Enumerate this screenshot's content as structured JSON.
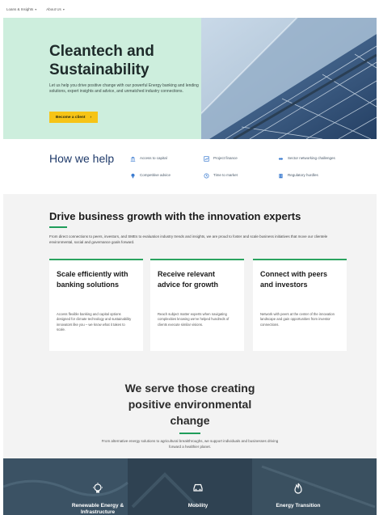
{
  "topnav": {
    "items": [
      {
        "label": "Loans & Insights"
      },
      {
        "label": "About Us"
      }
    ]
  },
  "hero": {
    "title": "Cleantech and Sustainability",
    "description": "Let us help you drive positive change with our powerful Energy banking and lending solutions, expert insights and advice, and unmatched industry connections.",
    "cta_label": "Become a client",
    "cta_color": "#f6c416",
    "bg_color": "#cdeedd"
  },
  "how": {
    "title": "How we help",
    "items": [
      {
        "label": "Access to capital",
        "icon": "bank-icon"
      },
      {
        "label": "Project finance",
        "icon": "chart-icon"
      },
      {
        "label": "Sector networking challenges",
        "icon": "handshake-icon"
      },
      {
        "label": "Competitive advice",
        "icon": "lightbulb-icon"
      },
      {
        "label": "Time to market",
        "icon": "clock-icon"
      },
      {
        "label": "Regulatory hurdles",
        "icon": "building-icon"
      }
    ]
  },
  "drive": {
    "title": "Drive business growth with the innovation experts",
    "lead": "From direct connections to peers, investors, and SMEs to evaluation industry trends and insights, we are proud to foster and scale business initiatives that move our clientele environmental, social and governance goals forward.",
    "accent": "#1f9d5a",
    "cards": [
      {
        "title": "Scale efficiently with banking solutions",
        "body": "Access flexible banking and capital options designed for climate technology and sustainability innovators like you – we know what it takes to scale."
      },
      {
        "title": "Receive relevant advice for growth",
        "body": "Reach subject matter experts when navigating complexities knowing we've helped hundreds of clients execute similar visions."
      },
      {
        "title": "Connect with peers and investors",
        "body": "Network with peers at the center of the innovation landscape and gain opportunities from investor connections."
      }
    ]
  },
  "serve": {
    "title": "We serve those creating positive environmental change",
    "subtitle": "From alternative energy solutions to agricultural breakthroughs, we support individuals and businesses driving forward a healthier planet."
  },
  "strip": {
    "tiles": [
      {
        "label": "Renewable Energy & Infrastructure",
        "icon": "lightbulb-icon"
      },
      {
        "label": "Mobility",
        "icon": "car-icon"
      },
      {
        "label": "Energy Transition",
        "icon": "flame-icon"
      }
    ]
  }
}
